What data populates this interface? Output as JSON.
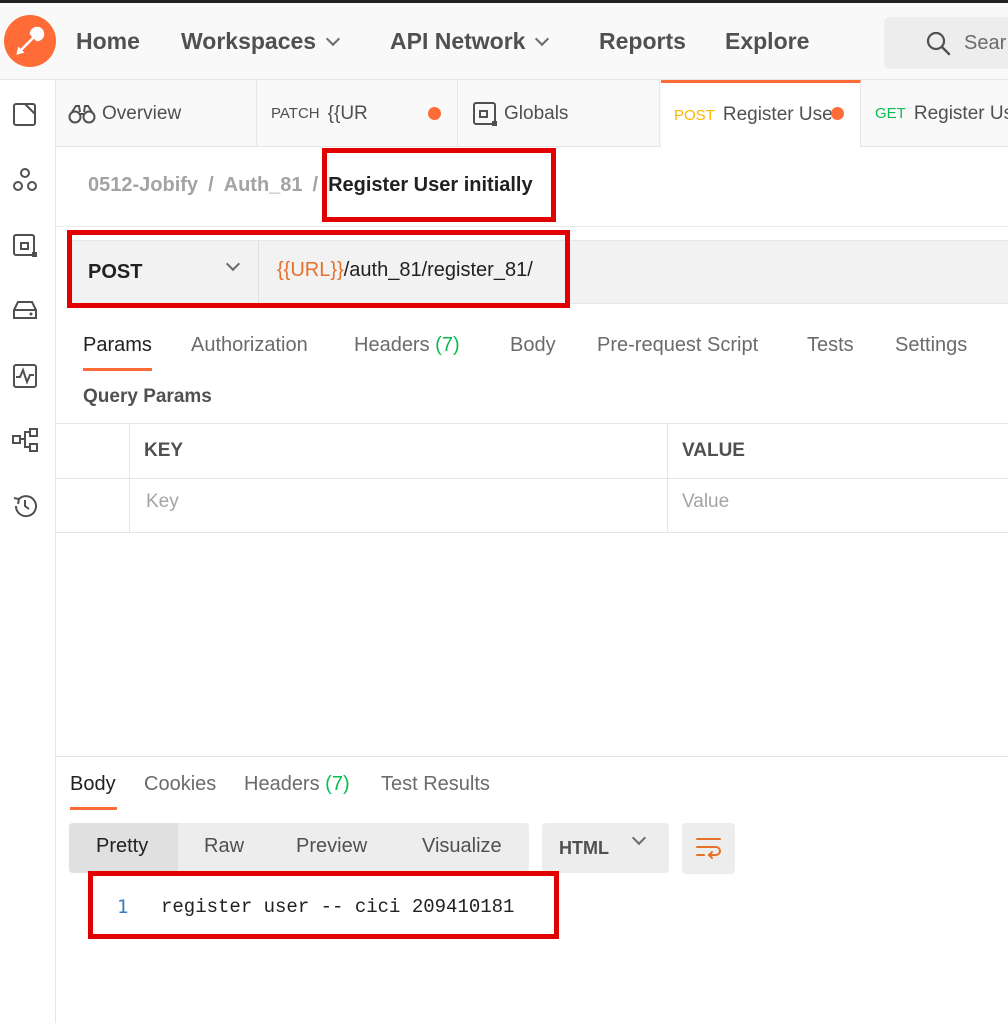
{
  "header": {
    "nav": [
      {
        "label": "Home",
        "has_chevron": false
      },
      {
        "label": "Workspaces",
        "has_chevron": true
      },
      {
        "label": "API Network",
        "has_chevron": true
      },
      {
        "label": "Reports",
        "has_chevron": false
      },
      {
        "label": "Explore",
        "has_chevron": false
      }
    ],
    "search_placeholder": "Sear"
  },
  "tabs": [
    {
      "method": "",
      "label": "Overview",
      "icon": "binoculars-icon",
      "unsaved": false
    },
    {
      "method": "PATCH",
      "label": "{{UR",
      "unsaved": true
    },
    {
      "method": "",
      "label": "Globals",
      "icon": "globals-icon",
      "unsaved": false
    },
    {
      "method": "POST",
      "label": "Register Use",
      "unsaved": true,
      "active": true
    },
    {
      "method": "GET",
      "label": "Register Us",
      "unsaved": false
    }
  ],
  "breadcrumb": {
    "collection": "0512-Jobify",
    "folder": "Auth_81",
    "separator": "/",
    "request": "Register User initially"
  },
  "request": {
    "method": "POST",
    "url_var": "{{URL}}",
    "url_path": "/auth_81/register_81/"
  },
  "request_tabs": [
    {
      "label": "Params",
      "count": ""
    },
    {
      "label": "Authorization",
      "count": ""
    },
    {
      "label": "Headers",
      "count": "(7)"
    },
    {
      "label": "Body",
      "count": ""
    },
    {
      "label": "Pre-request Script",
      "count": ""
    },
    {
      "label": "Tests",
      "count": ""
    },
    {
      "label": "Settings",
      "count": ""
    }
  ],
  "query_params": {
    "title": "Query Params",
    "key_header": "KEY",
    "value_header": "VALUE",
    "key_placeholder": "Key",
    "value_placeholder": "Value"
  },
  "response_tabs": [
    {
      "label": "Body",
      "count": ""
    },
    {
      "label": "Cookies",
      "count": ""
    },
    {
      "label": "Headers",
      "count": "(7)"
    },
    {
      "label": "Test Results",
      "count": ""
    }
  ],
  "view_modes": [
    "Pretty",
    "Raw",
    "Preview",
    "Visualize"
  ],
  "format": "HTML",
  "response_body": {
    "line_number": "1",
    "text": "register user -- cici 209410181"
  },
  "colors": {
    "accent": "#ff6c37",
    "post": "#ffb400",
    "get": "#0cbb52",
    "annotation": "#e30000",
    "url_var": "#e8702a"
  }
}
